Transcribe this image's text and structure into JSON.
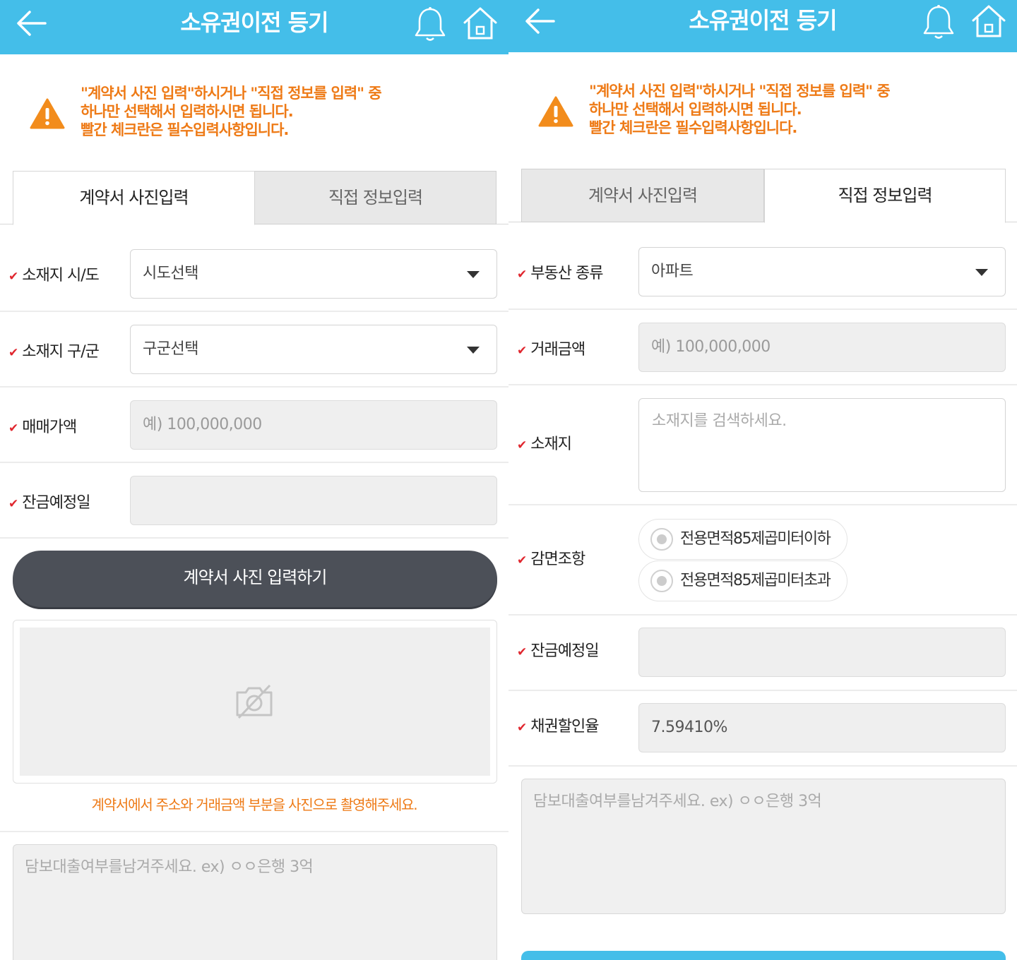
{
  "header": {
    "title": "소유권이전 등기"
  },
  "notice": {
    "line1": "\"계약서 사진 입력\"하시거나 \"직접 정보를 입력\" 중",
    "line2": "하나만 선택해서 입력하시면 됩니다.",
    "line3": "빨간 체크란은 필수입력사항입니다."
  },
  "tabs": {
    "photo": "계약서 사진입력",
    "direct": "직접 정보입력"
  },
  "check_mark": "✔",
  "left": {
    "sido_label": "소재지 시/도",
    "sido_value": "시도선택",
    "gugun_label": "소재지 구/군",
    "gugun_value": "구군선택",
    "price_label": "매매가액",
    "price_placeholder": "예) 100,000,000",
    "balance_date_label": "잔금예정일",
    "balance_date_value": "",
    "photo_button": "계약서 사진 입력하기",
    "photo_hint": "계약서에서 주소와 거래금액 부분을 사진으로 촬영해주세요.",
    "memo_placeholder": "담보대출여부를남겨주세요. ex) ㅇㅇ은행 3억"
  },
  "right": {
    "type_label": "부동산 종류",
    "type_value": "아파트",
    "amount_label": "거래금액",
    "amount_placeholder": "예) 100,000,000",
    "address_label": "소재지",
    "address_placeholder": "소재지를 검색하세요.",
    "reduction_label": "감면조항",
    "reduction_option1": "전용면적85제곱미터이하",
    "reduction_option2": "전용면적85제곱미터초과",
    "balance_date_label": "잔금예정일",
    "balance_date_value": "",
    "discount_label": "채권할인율",
    "discount_value": "7.59410%",
    "memo_placeholder": "담보대출여부를남겨주세요. ex) ㅇㅇ은행 3억"
  },
  "colors": {
    "header": "#44bee9",
    "notice_text": "#ee7a16",
    "check": "#e0262e",
    "primary_button": "#4c5058"
  }
}
